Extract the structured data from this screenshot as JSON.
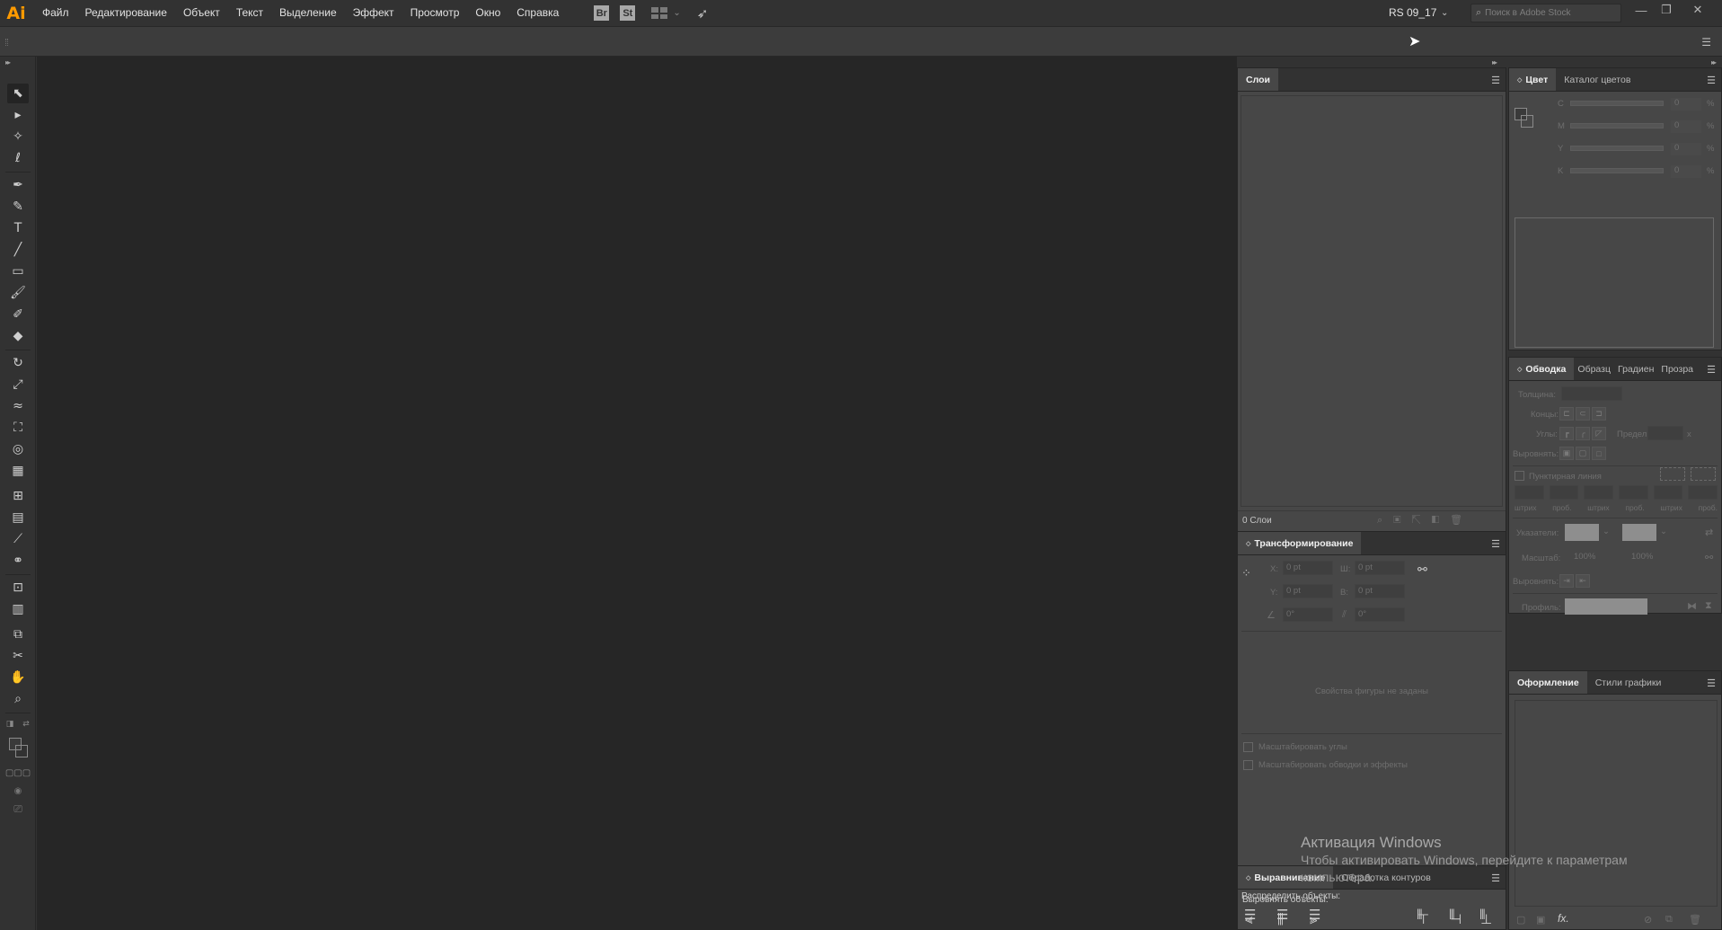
{
  "app": {
    "logo_text": "Ai",
    "logo_color": "#ff9a00"
  },
  "menu": [
    "Файл",
    "Редактирование",
    "Объект",
    "Текст",
    "Выделение",
    "Эффект",
    "Просмотр",
    "Окно",
    "Справка"
  ],
  "bridge_icons": {
    "br": "Br",
    "st": "St"
  },
  "workspace": "RS 09_17",
  "stock_search": {
    "placeholder": "Поиск в Adobe Stock"
  },
  "window_controls": {
    "minimize": "—",
    "restore": "❐",
    "close": "✕"
  },
  "layers_panel": {
    "tab": "Слои",
    "footer_count": "0 Слои"
  },
  "transform_panel": {
    "tab": "Трансформирование",
    "x_label": "X:",
    "x_value": "0 pt",
    "w_label": "Ш:",
    "w_value": "0 pt",
    "y_label": "Y:",
    "y_value": "0 pt",
    "h_label": "В:",
    "h_value": "0 pt",
    "angle_value": "0°",
    "shear_value": "0°",
    "no_shape": "Свойства фигуры не заданы",
    "scale_corners": "Масштабировать углы",
    "scale_strokes": "Масштабировать обводки и эффекты"
  },
  "align_panel": {
    "tabs": [
      "Выравнивание",
      "Обработка контуров"
    ],
    "align_objects": "Выровнять объекты:",
    "distribute_objects": "Распределить объекты:"
  },
  "color_panel": {
    "tabs": [
      "Цвет",
      "Каталог цветов"
    ],
    "channels": [
      {
        "label": "C",
        "value": "0",
        "unit": "%"
      },
      {
        "label": "M",
        "value": "0",
        "unit": "%"
      },
      {
        "label": "Y",
        "value": "0",
        "unit": "%"
      },
      {
        "label": "K",
        "value": "0",
        "unit": "%"
      }
    ]
  },
  "stroke_panel": {
    "tabs": [
      "Обводка",
      "Образц",
      "Градиен",
      "Прозра"
    ],
    "weight": "Толщина:",
    "caps": "Концы:",
    "corners": "Углы:",
    "limit": "Предел:",
    "limit_unit": "x",
    "align": "Выровнять:",
    "dashed": "Пунктирная линия",
    "dash_labels": [
      "штрих",
      "проб.",
      "штрих",
      "проб.",
      "штрих",
      "проб."
    ],
    "arrows": "Указатели:",
    "scale": "Масштаб:",
    "scale_value_1": "100%",
    "scale_value_2": "100%",
    "align_arrows": "Выровнять:",
    "profile": "Профиль:"
  },
  "appearance_panel": {
    "tabs": [
      "Оформление",
      "Стили графики"
    ],
    "fx": "fx."
  },
  "watermark": {
    "title": "Активация Windows",
    "subtitle": "Чтобы активировать Windows, перейдите к параметрам компьютера."
  }
}
